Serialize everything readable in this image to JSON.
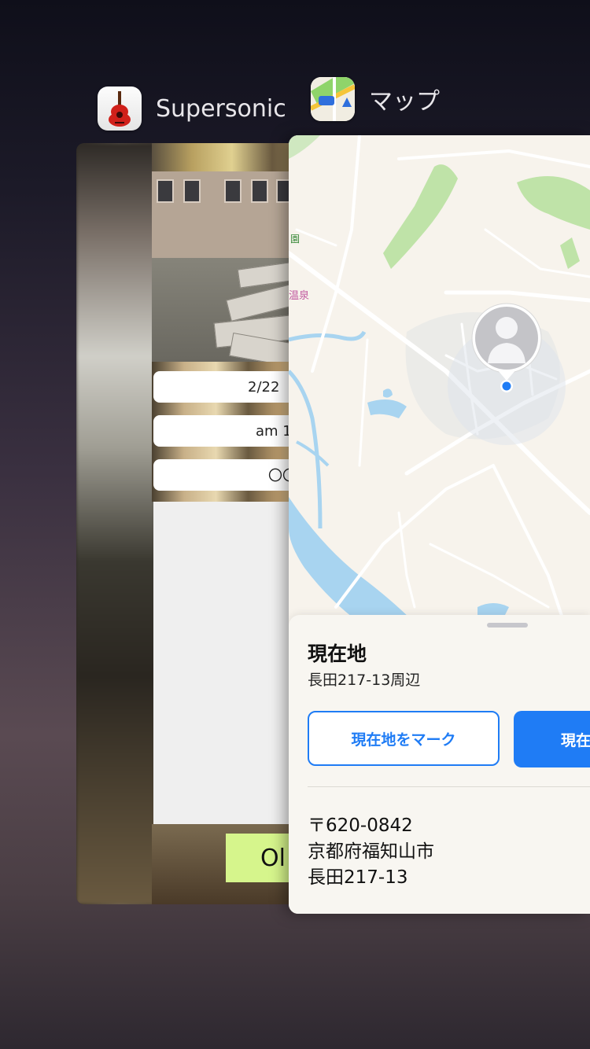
{
  "switcher": {
    "apps": [
      {
        "name": "Supersonic",
        "icon": "guitar-icon"
      },
      {
        "name": "マップ",
        "icon": "maps-app-icon"
      }
    ]
  },
  "supersonic_card": {
    "date_field": "2/22",
    "time_field": "am 1",
    "place_field": "〇〇",
    "ok_label": "Ol"
  },
  "maps_card": {
    "map_labels": {
      "poi1": "園",
      "poi2": "温泉"
    },
    "sheet": {
      "title": "現在地",
      "subtitle": "長田217-13周辺",
      "mark_button": "現在地をマーク",
      "share_button": "現在",
      "address_lines": [
        "〒620-0842",
        "京都府福知山市",
        "長田217-13"
      ]
    },
    "colors": {
      "accent": "#1f7cf5",
      "water": "#a8d4f0",
      "park": "#bfe3a8"
    }
  }
}
